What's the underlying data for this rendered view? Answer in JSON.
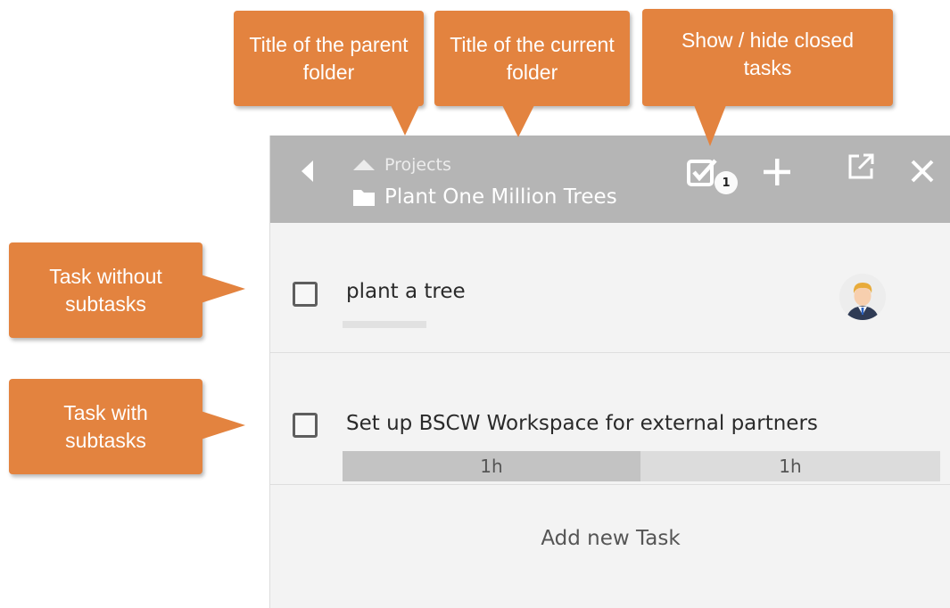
{
  "callouts": {
    "parent_folder": "Title of the parent\nfolder",
    "current_folder": "Title of the current\nfolder",
    "show_hide_closed": "Show / hide closed\ntasks",
    "task_without_subtasks": "Task without\nsubtasks",
    "task_with_subtasks": "Task with\nsubtasks"
  },
  "header": {
    "parent_title": "Projects",
    "current_title": "Plant One Million Trees",
    "closed_count": "1"
  },
  "tasks": [
    {
      "title": "plant a tree"
    },
    {
      "title": "Set up BSCW Workspace for external partners",
      "subtasks": [
        "1h",
        "1h"
      ]
    }
  ],
  "add_task_label": "Add new Task",
  "icons": [
    "back-icon",
    "triangle-up-icon",
    "folder-icon",
    "checkbox-checked-icon",
    "plus-icon",
    "open-external-icon",
    "close-icon"
  ],
  "colors": {
    "callout": "#e3833f",
    "header": "#b5b5b5",
    "panel": "#f3f3f3"
  }
}
